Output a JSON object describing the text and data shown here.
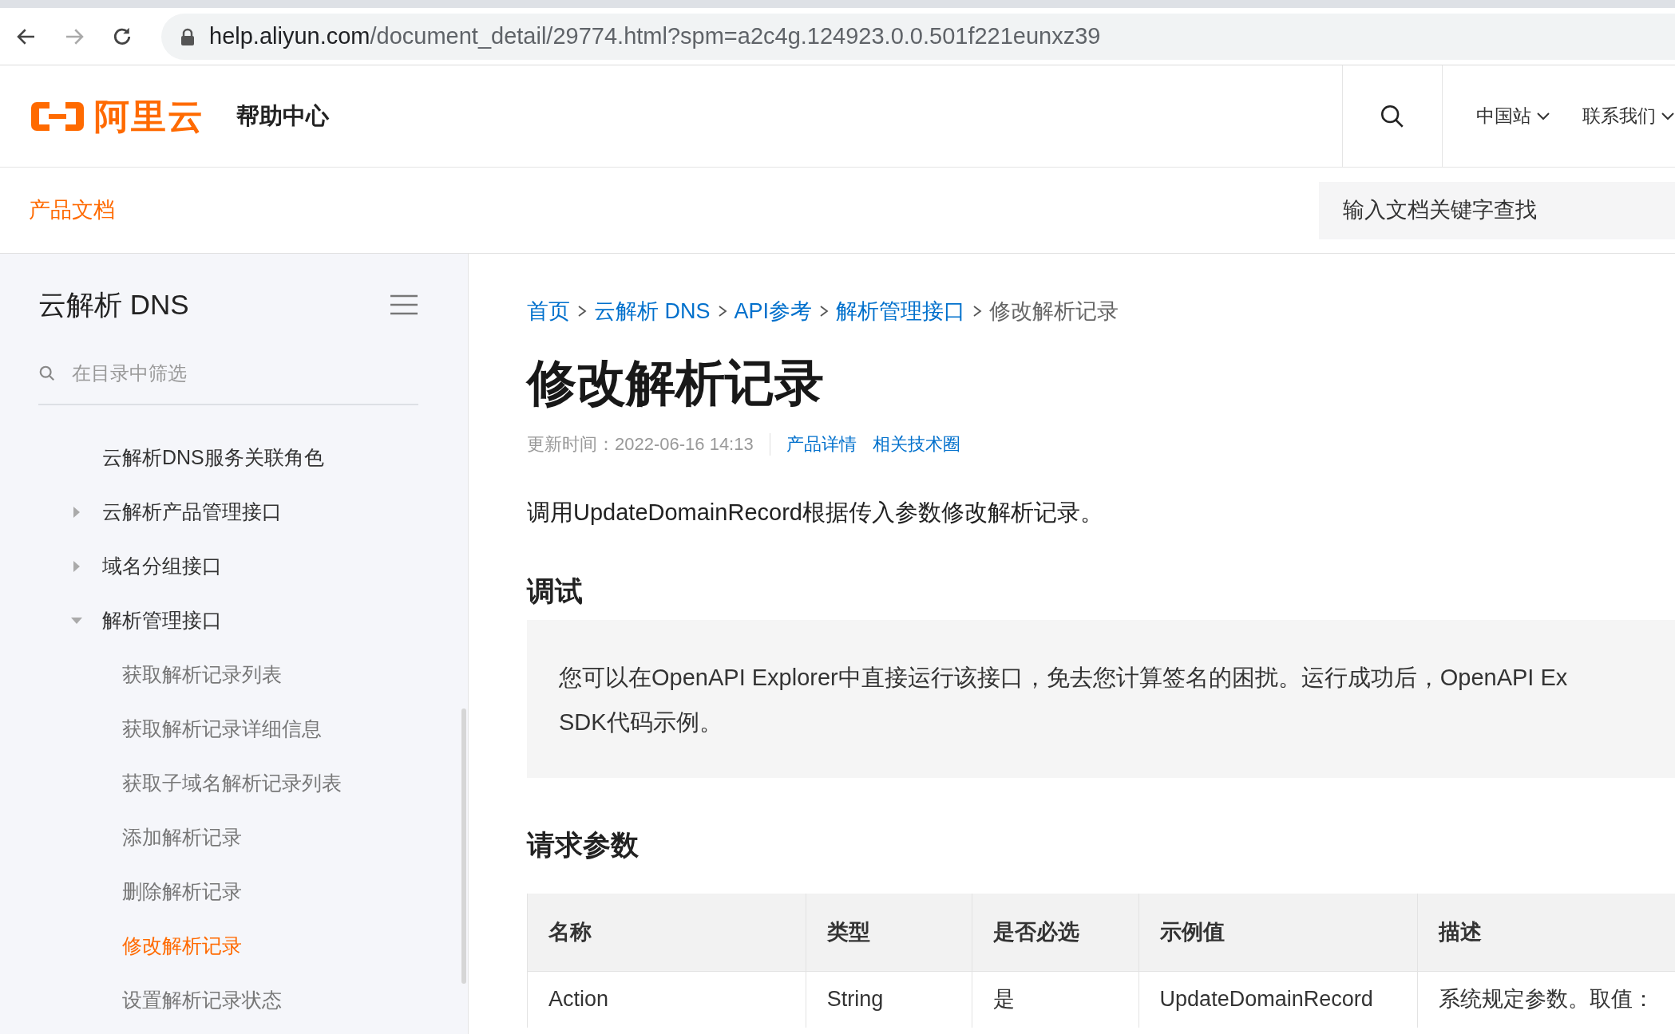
{
  "browser": {
    "url_host": "help.aliyun.com",
    "url_path": "/document_detail/29774.html?spm=a2c4g.124923.0.0.501f221eunxz39"
  },
  "header": {
    "logo_text": "阿里云",
    "site_title": "帮助中心",
    "menus": [
      {
        "label": "中国站"
      },
      {
        "label": "联系我们"
      }
    ]
  },
  "subnav": {
    "label": "产品文档",
    "search": {
      "placeholder": "输入文档关键字查找"
    }
  },
  "sidebar": {
    "title": "云解析 DNS",
    "filter": {
      "placeholder": "在目录中筛选"
    },
    "items": [
      {
        "label": "云解析DNS服务关联角色",
        "kind": "leaf",
        "selected": false
      },
      {
        "label": "云解析产品管理接口",
        "kind": "group",
        "expanded": false,
        "selected": false
      },
      {
        "label": "域名分组接口",
        "kind": "group",
        "expanded": false,
        "selected": false
      },
      {
        "label": "解析管理接口",
        "kind": "group",
        "expanded": true,
        "selected": false,
        "children": [
          {
            "label": "获取解析记录列表",
            "selected": false
          },
          {
            "label": "获取解析记录详细信息",
            "selected": false
          },
          {
            "label": "获取子域名解析记录列表",
            "selected": false
          },
          {
            "label": "添加解析记录",
            "selected": false
          },
          {
            "label": "删除解析记录",
            "selected": false
          },
          {
            "label": "修改解析记录",
            "selected": true
          },
          {
            "label": "设置解析记录状态",
            "selected": false
          }
        ]
      }
    ]
  },
  "content": {
    "breadcrumb": [
      {
        "label": "首页",
        "kind": "link"
      },
      {
        "label": "云解析 DNS",
        "kind": "link"
      },
      {
        "label": "API参考",
        "kind": "link"
      },
      {
        "label": "解析管理接口",
        "kind": "link"
      },
      {
        "label": "修改解析记录",
        "kind": "current"
      }
    ],
    "title": "修改解析记录",
    "updated": "更新时间：2022-06-16 14:13",
    "meta_links": [
      "产品详情",
      "相关技术圈"
    ],
    "intro": "调用UpdateDomainRecord根据传入参数修改解析记录。",
    "sections": [
      {
        "heading": "调试",
        "note_lines": [
          "您可以在OpenAPI Explorer中直接运行该接口，免去您计算签名的困扰。运行成功后，OpenAPI Ex",
          "SDK代码示例。"
        ]
      },
      {
        "heading": "请求参数",
        "table": {
          "columns": [
            "名称",
            "类型",
            "是否必选",
            "示例值",
            "描述"
          ],
          "rows": [
            [
              "Action",
              "String",
              "是",
              "UpdateDomainRecord",
              "系统规定参数。取值："
            ]
          ]
        }
      }
    ]
  }
}
